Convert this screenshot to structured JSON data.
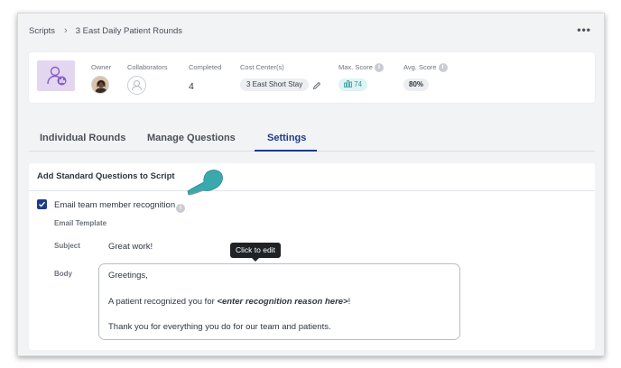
{
  "breadcrumb": {
    "root": "Scripts",
    "current": "3 East Daily Patient Rounds"
  },
  "header": {
    "more_label": "•••"
  },
  "info": {
    "owner_label": "Owner",
    "collaborators_label": "Collaborators",
    "completed_label": "Completed",
    "completed_value": "4",
    "cost_center_label": "Cost Center(s)",
    "cost_center_value": "3 East Short Stay",
    "max_score_label": "Max. Score",
    "max_score_value": "74",
    "avg_score_label": "Avg. Score",
    "avg_score_value": "80%"
  },
  "tabs": [
    {
      "label": "Individual Rounds"
    },
    {
      "label": "Manage Questions"
    },
    {
      "label": "Settings"
    }
  ],
  "settings": {
    "section_title": "Add Standard Questions to Script",
    "checkbox_label": "Email team member recognition",
    "template_label": "Email Template",
    "subject_label": "Subject",
    "subject_value": "Great work!",
    "body_label": "Body",
    "body_line1": "Greetings,",
    "body_line2_prefix": "A patient recognized you for ",
    "body_line2_placeholder": "<enter recognition reason here>",
    "body_line2_suffix": "!",
    "body_line3": "Thank you for everything you do for our team and patients.",
    "tooltip": "Click to edit"
  },
  "colors": {
    "accent": "#1e3a8a",
    "teal": "#2a9a9f",
    "icon_bg": "#e3d6f0"
  },
  "icons": {
    "info": "i"
  }
}
